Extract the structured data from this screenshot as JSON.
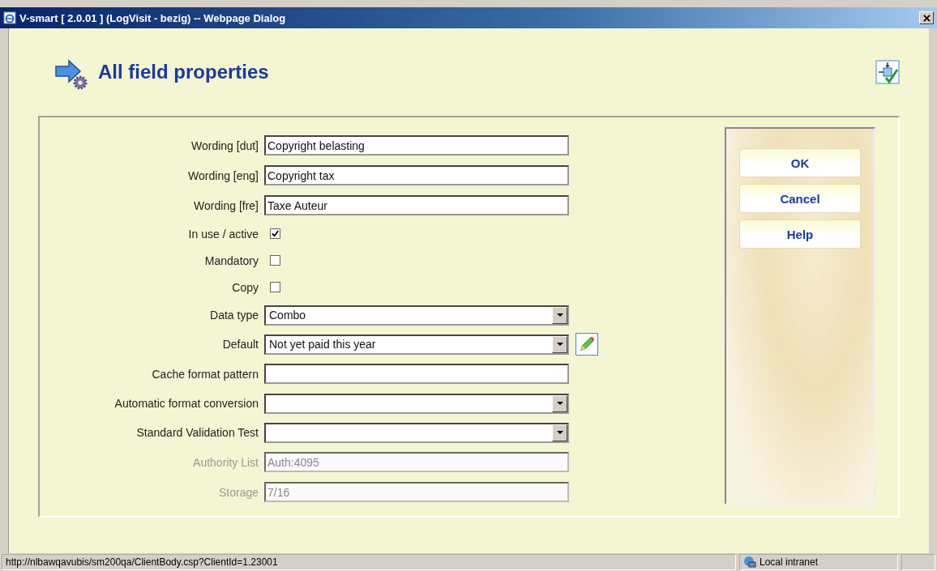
{
  "window": {
    "title": "V-smart [ 2.0.01 ] (LogVisit - bezig) -- Webpage Dialog"
  },
  "page": {
    "title": "All field properties"
  },
  "fields": [
    {
      "kind": "text",
      "label": "Wording [dut]",
      "value": "Copyright belasting",
      "disabled": false
    },
    {
      "kind": "text",
      "label": "Wording [eng]",
      "value": "Copyright tax",
      "disabled": false
    },
    {
      "kind": "text",
      "label": "Wording [fre]",
      "value": "Taxe Auteur",
      "disabled": false
    },
    {
      "kind": "checkbox",
      "label": "In use / active",
      "checked": true
    },
    {
      "kind": "checkbox",
      "label": "Mandatory",
      "checked": false
    },
    {
      "kind": "checkbox",
      "label": "Copy",
      "checked": false
    },
    {
      "kind": "dropdown",
      "label": "Data type",
      "value": "Combo",
      "edit_button": false
    },
    {
      "kind": "dropdown",
      "label": "Default",
      "value": "Not yet paid this year",
      "edit_button": true
    },
    {
      "kind": "text",
      "label": "Cache format pattern",
      "disabled": false
    },
    {
      "kind": "dropdown",
      "label": "Automatic format conversion",
      "edit_button": false
    },
    {
      "kind": "dropdown",
      "label": "Standard Validation Test",
      "edit_button": false
    },
    {
      "kind": "text",
      "label": "Authority List",
      "value": "Auth:4095",
      "disabled": true
    },
    {
      "kind": "text",
      "label": "Storage",
      "value": "7/16",
      "disabled": true
    }
  ],
  "buttons": [
    "OK",
    "Cancel",
    "Help"
  ],
  "status_bar": {
    "url": "http://nlbawqavubis/sm200qa/ClientBody.csp?ClientId=1.23001",
    "zone": "Local intranet"
  }
}
